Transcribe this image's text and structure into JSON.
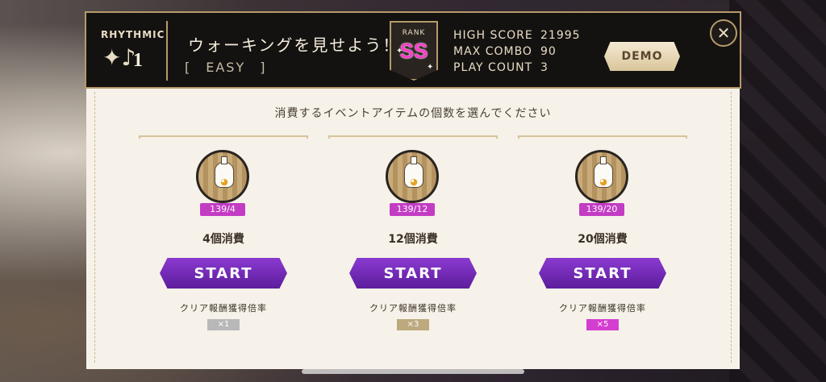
{
  "header": {
    "mode": "RHYTHMIC",
    "song_number": "1",
    "title": "ウォーキングを見せよう！",
    "difficulty": "[　EASY　]",
    "rank_label": "RANK",
    "rank": "SS",
    "stats": [
      {
        "label": "HIGH SCORE",
        "value": "21995"
      },
      {
        "label": "MAX COMBO",
        "value": "90"
      },
      {
        "label": "PLAY COUNT",
        "value": "3"
      }
    ],
    "demo_label": "DEMO",
    "close_icon": "close-icon"
  },
  "panel": {
    "instruction": "消費するイベントアイテムの個数を選んでください",
    "cards": [
      {
        "count": "139/4",
        "consume": "4個消費",
        "start": "START",
        "rate_label": "クリア報酬獲得倍率",
        "multiplier": "×1",
        "mult_color": "#b8b8b8"
      },
      {
        "count": "139/12",
        "consume": "12個消費",
        "start": "START",
        "rate_label": "クリア報酬獲得倍率",
        "multiplier": "×3",
        "mult_color": "#bda97e"
      },
      {
        "count": "139/20",
        "consume": "20個消費",
        "start": "START",
        "rate_label": "クリア報酬獲得倍率",
        "multiplier": "×5",
        "mult_color": "#d43ed0"
      }
    ]
  },
  "colors": {
    "accent_gold": "#b59b6b",
    "start_purple": "#6f26b6",
    "badge_magenta": "#c33cc4",
    "rank_pink": "#ff3cc8"
  }
}
